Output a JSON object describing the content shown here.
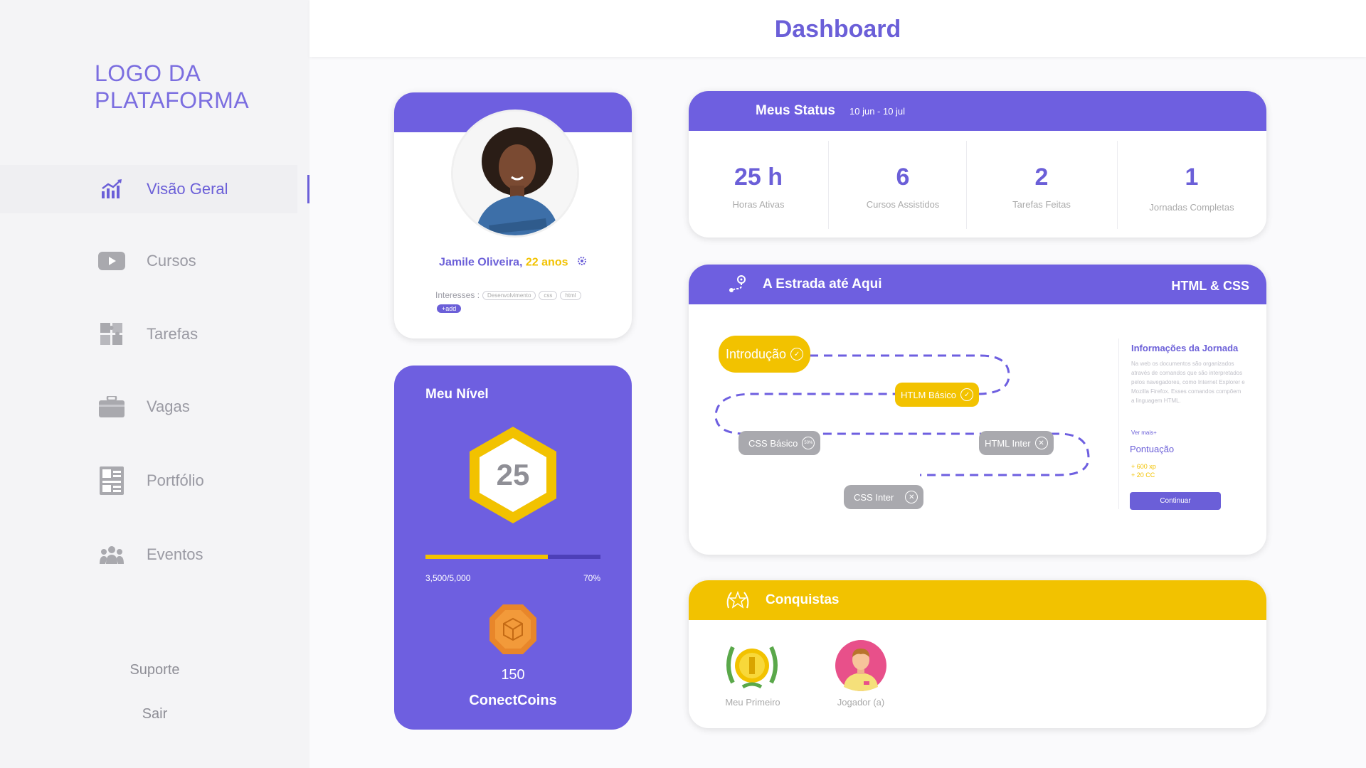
{
  "sidebar": {
    "logo": "LOGO DA\nPLATAFORMA",
    "items": [
      {
        "label": "Visão Geral",
        "icon": "chart-icon"
      },
      {
        "label": "Cursos",
        "icon": "play-icon"
      },
      {
        "label": "Tarefas",
        "icon": "puzzle-icon"
      },
      {
        "label": "Vagas",
        "icon": "briefcase-icon"
      },
      {
        "label": "Portfólio",
        "icon": "portfolio-icon"
      },
      {
        "label": "Eventos",
        "icon": "people-icon"
      }
    ],
    "support": "Suporte",
    "logout": "Sair"
  },
  "header": {
    "title": "Dashboard"
  },
  "profile": {
    "name": "Jamile Oliveira,",
    "age": "22 anos",
    "interests_label": "Interesses :",
    "tags": [
      "Desenvolvimento",
      "css",
      "html"
    ],
    "add": "+add"
  },
  "level": {
    "title": "Meu Nível",
    "value": "25",
    "progress_text": "3,500/5,000",
    "progress_percent": "70%",
    "progress_fraction": 0.7,
    "coins": "150",
    "coins_label": "ConectCoins"
  },
  "status": {
    "title": "Meus Status",
    "range": "10 jun - 10 jul",
    "stats": [
      {
        "value": "25 h",
        "label": "Horas Ativas"
      },
      {
        "value": "6",
        "label": "Cursos Assistidos"
      },
      {
        "value": "2",
        "label": "Tarefas Feitas"
      },
      {
        "value": "1",
        "label": "Jornadas Completas"
      }
    ]
  },
  "road": {
    "title": "A Estrada até Aqui",
    "track": "HTML & CSS",
    "nodes": [
      {
        "label": "Introdução",
        "state": "done"
      },
      {
        "label": "HTLM Básico",
        "state": "done"
      },
      {
        "label": "CSS Básico",
        "state": "50%"
      },
      {
        "label": "HTML Inter",
        "state": "locked"
      },
      {
        "label": "CSS Inter",
        "state": "locked"
      }
    ],
    "info_title": "Informações da Jornada",
    "info_desc": "Na web os documentos são organizados através de comandos que são interpretados pelos navegadores, como Internet Explorer e Mozilla Firefox. Esses comandos compõem a linguagem HTML.",
    "info_more": "Ver mais+",
    "score_label": "Pontuação",
    "xp": "+ 600 xp",
    "cc": "+ 20 CC",
    "continue": "Continuar"
  },
  "achievements": {
    "title": "Conquistas",
    "items": [
      {
        "label": "Meu Primeiro"
      },
      {
        "label": "Jogador (a)"
      }
    ]
  },
  "colors": {
    "accent": "#6e5fe0",
    "yellow": "#f2c200",
    "gray": "#a9a9ae"
  }
}
